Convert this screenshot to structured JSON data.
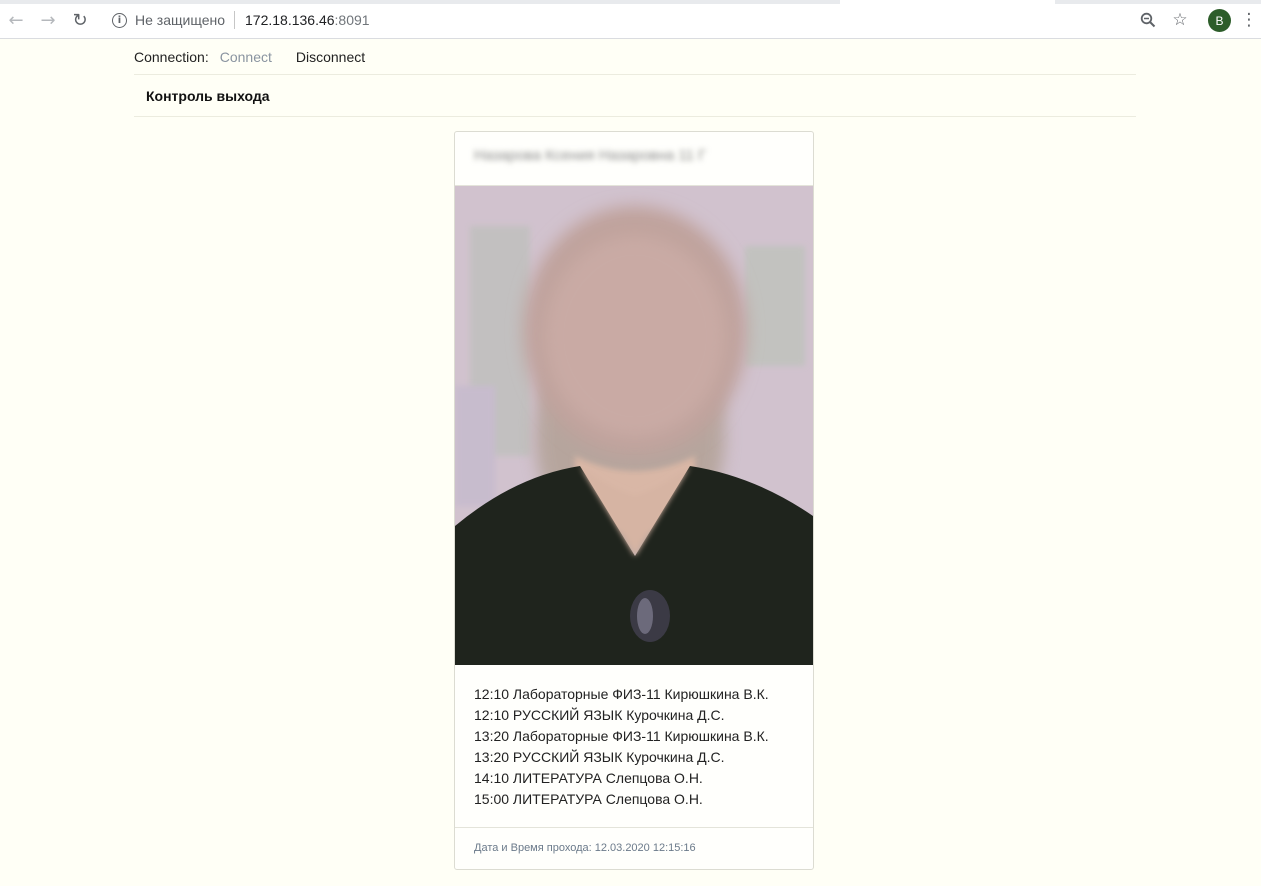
{
  "browser": {
    "security_label": "Не защищено",
    "url_host": "172.18.136.46",
    "url_port": ":8091",
    "profile_initial": "B"
  },
  "connection": {
    "label": "Connection:",
    "connect": "Connect",
    "disconnect": "Disconnect"
  },
  "section": {
    "title": "Контроль выхода"
  },
  "card": {
    "person_name": "Назарова Ксения Назаровна 11 Г",
    "schedule": [
      "12:10 Лабораторные ФИЗ-11 Кирюшкина В.К.",
      "12:10 РУССКИЙ ЯЗЫК Курочкина Д.С.",
      "13:20 Лабораторные ФИЗ-11 Кирюшкина В.К.",
      "13:20 РУССКИЙ ЯЗЫК Курочкина Д.С.",
      "14:10 ЛИТЕРАТУРА Слепцова О.Н.",
      "15:00 ЛИТЕРАТУРА Слепцова О.Н."
    ],
    "pass_datetime": "Дата и Время прохода: 12.03.2020 12:15:16"
  }
}
